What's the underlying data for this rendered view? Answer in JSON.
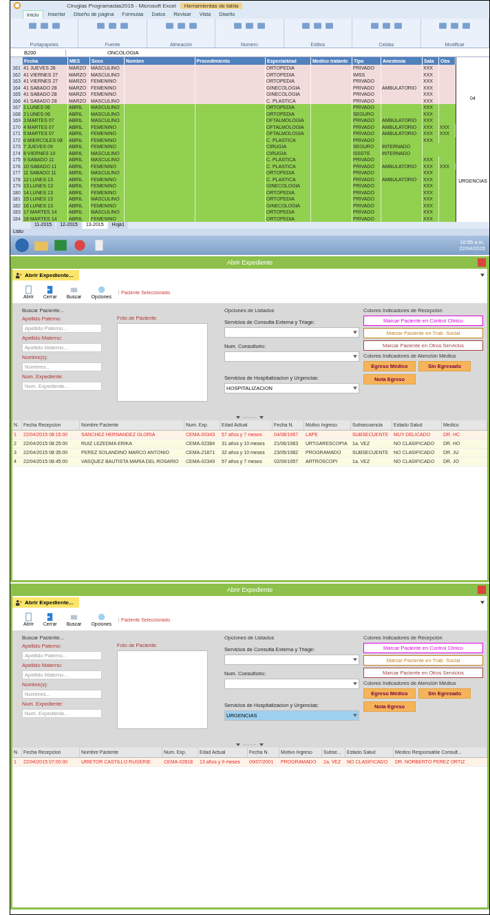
{
  "spreadsheet": {
    "title": "Cirugias Programadas2015 - Microsoft Excel",
    "tools_title": "Herramientas de tabla",
    "ribbon_tabs": [
      {
        "label": "Inicio",
        "selected": true
      },
      {
        "label": "Insertar",
        "selected": false
      },
      {
        "label": "Diseño de página",
        "selected": false
      },
      {
        "label": "Fórmulas",
        "selected": false
      },
      {
        "label": "Datos",
        "selected": false
      },
      {
        "label": "Revisar",
        "selected": false
      },
      {
        "label": "Vista",
        "selected": false
      },
      {
        "label": "Diseño",
        "selected": false
      }
    ],
    "ribbon_groups": [
      "Portapapeles",
      "Fuente",
      "Alineación",
      "Número",
      "Estilos",
      "Celdas",
      "Modificar"
    ],
    "name_box": "B200",
    "formula": "ONCOLOGIA",
    "columns": [
      "Fecha",
      "MES",
      "Sexo",
      "Nombre",
      "Procedimiento",
      "Especialidad",
      "Medico tratante",
      "Tipo",
      "Anestesia",
      "Sala",
      "Obs"
    ],
    "rows": [
      {
        "n": "161",
        "color": "#f2dcdb",
        "fecha": "41 JUEVES 26",
        "mes": "MARZO",
        "sexo": "MASCULINO",
        "esp": "ORTOPEDIA",
        "tipo": "PRIVADO",
        "marks": [
          "XXX"
        ]
      },
      {
        "n": "162",
        "color": "#f2dcdb",
        "fecha": "41 VIERNES 27",
        "mes": "MARZO",
        "sexo": "MASCULINO",
        "esp": "ORTOPEDIA",
        "tipo": "IMSS",
        "marks": [
          "XXX"
        ]
      },
      {
        "n": "163",
        "color": "#f2dcdb",
        "fecha": "41 VIERNES 27",
        "mes": "MARZO",
        "sexo": "FEMENINO",
        "esp": "ORTOPEDIA",
        "tipo": "PRIVADO",
        "marks": [
          "XXX"
        ]
      },
      {
        "n": "164",
        "color": "#f2dcdb",
        "fecha": "41 SABADO 28",
        "mes": "MARZO",
        "sexo": "FEMENINO",
        "esp": "GINECOLOGIA",
        "tipo": "PRIVADO",
        "anestesia": "AMBULATORIO",
        "marks": [
          "XXX"
        ]
      },
      {
        "n": "165",
        "color": "#f2dcdb",
        "fecha": "41 SABADO 28",
        "mes": "MARZO",
        "sexo": "FEMENINO",
        "esp": "GINECOLOGIA",
        "tipo": "PRIVADO",
        "marks": [
          "XXX"
        ]
      },
      {
        "n": "166",
        "color": "#f2dcdb",
        "fecha": "41 SABADO 28",
        "mes": "MARZO",
        "sexo": "MASCULINO",
        "esp": "C. PLASTICA",
        "tipo": "PRIVADO",
        "marks": [
          "XXX"
        ]
      },
      {
        "n": "167",
        "color": "#92d050",
        "fecha": "1 LUNES 06",
        "mes": "ABRIL",
        "sexo": "MASCULINO",
        "esp": "ORTOPEDIA",
        "tipo": "PRIVADO",
        "marks": [
          "XXX"
        ]
      },
      {
        "n": "168",
        "color": "#92d050",
        "fecha": "2 LUNES 06",
        "mes": "ABRIL",
        "sexo": "MASCULINO",
        "esp": "ORTOPEDIA",
        "tipo": "SEGURO",
        "marks": [
          "XXX"
        ]
      },
      {
        "n": "169",
        "color": "#92d050",
        "fecha": "3 MARTES 07",
        "mes": "ABRIL",
        "sexo": "MASCULINO",
        "esp": "OFTALMOLOGIA",
        "tipo": "PRIVADO",
        "anestesia": "AMBULATORIO",
        "marks": [
          "XXX"
        ]
      },
      {
        "n": "170",
        "color": "#92d050",
        "fecha": "4 MARTES 07",
        "mes": "ABRIL",
        "sexo": "FEMENINO",
        "esp": "OFTALMOLOGIA",
        "tipo": "PRIVADO",
        "anestesia": "AMBULATORIO",
        "marks": [
          "XXX",
          "XXX"
        ]
      },
      {
        "n": "171",
        "color": "#92d050",
        "fecha": "5 MARTES 07",
        "mes": "ABRIL",
        "sexo": "FEMENINO",
        "esp": "OFTALMOLOGIA",
        "tipo": "PRIVADO",
        "anestesia": "AMBULATORIO",
        "marks": [
          "XXX",
          "XXX"
        ]
      },
      {
        "n": "172",
        "color": "#92d050",
        "fecha": "6 MIERCOLES 08",
        "mes": "ABRIL",
        "sexo": "FEMENINO",
        "esp": "C. PLASTICA",
        "tipo": "PRIVADO",
        "marks": [
          "XXX"
        ]
      },
      {
        "n": "173",
        "color": "#92d050",
        "fecha": "7 JUEVES 09",
        "mes": "ABRIL",
        "sexo": "FEMENINO",
        "esp": "CIRUGIA",
        "tipo": "SEGURO",
        "anestesia": "INTERNADO",
        "marks": []
      },
      {
        "n": "174",
        "color": "#92d050",
        "fecha": "8 VIERNES 10",
        "mes": "ABRIL",
        "sexo": "MASCULINO",
        "esp": "CIRUGIA",
        "tipo": "ISSSTE",
        "anestesia": "INTERNADO",
        "marks": []
      },
      {
        "n": "175",
        "color": "#92d050",
        "fecha": "9 SABADO 11",
        "mes": "ABRIL",
        "sexo": "MASCULINO",
        "esp": "C. PLASTICA",
        "tipo": "PRIVADO",
        "marks": [
          "XXX"
        ]
      },
      {
        "n": "176",
        "color": "#92d050",
        "fecha": "10 SABADO 11",
        "mes": "ABRIL",
        "sexo": "FEMENINO",
        "esp": "C. PLASTICA",
        "tipo": "PRIVADO",
        "anestesia": "AMBULATORIO",
        "marks": [
          "XXX",
          "XXX"
        ]
      },
      {
        "n": "177",
        "color": "#92d050",
        "fecha": "11 SABADO 11",
        "mes": "ABRIL",
        "sexo": "MASCULINO",
        "esp": "ORTOPEDIA",
        "tipo": "PRIVADO",
        "marks": [
          "XXX"
        ]
      },
      {
        "n": "178",
        "color": "#92d050",
        "fecha": "12 LUNES 13",
        "mes": "ABRIL",
        "sexo": "FEMENINO",
        "esp": "C. PLASTICA",
        "tipo": "PRIVADO",
        "anestesia": "AMBULATORIO",
        "marks": [
          "XXX"
        ]
      },
      {
        "n": "179",
        "color": "#92d050",
        "fecha": "13 LUNES 13",
        "mes": "ABRIL",
        "sexo": "FEMENINO",
        "esp": "GINECOLOGIA",
        "tipo": "PRIVADO",
        "marks": [
          "XXX"
        ]
      },
      {
        "n": "180",
        "color": "#92d050",
        "fecha": "14 LUNES 13",
        "mes": "ABRIL",
        "sexo": "FEMENINO",
        "esp": "ORTOPEDIA",
        "tipo": "PRIVADO",
        "marks": [
          "XXX"
        ]
      },
      {
        "n": "181",
        "color": "#92d050",
        "fecha": "15 LUNES 13",
        "mes": "ABRIL",
        "sexo": "MASCULINO",
        "esp": "ORTOPEDIA",
        "tipo": "PRIVADO",
        "marks": [
          "XXX"
        ]
      },
      {
        "n": "182",
        "color": "#92d050",
        "fecha": "16 LUNES 13",
        "mes": "ABRIL",
        "sexo": "FEMENINO",
        "esp": "GINECOLOGIA",
        "tipo": "PRIVADO",
        "marks": [
          "XXX"
        ]
      },
      {
        "n": "183",
        "color": "#92d050",
        "fecha": "17 MARTES 14",
        "mes": "ABRIL",
        "sexo": "MASCULINO",
        "esp": "ORTOPEDIA",
        "tipo": "PRIVADO",
        "marks": [
          "XXX"
        ]
      },
      {
        "n": "184",
        "color": "#92d050",
        "fecha": "18 MARTES 14",
        "mes": "ABRIL",
        "sexo": "FEMENINO",
        "esp": "ORTOPEDIA",
        "tipo": "PRIVADO",
        "marks": [
          "XXX"
        ]
      }
    ],
    "side_labels": [
      "04",
      "URGENCIAS"
    ],
    "sheet_tabs": [
      {
        "label": "11-2015",
        "selected": false
      },
      {
        "label": "12-2015",
        "selected": false
      },
      {
        "label": "13-2015",
        "selected": true
      },
      {
        "label": "Hoja1",
        "selected": false
      }
    ],
    "status": "Listo"
  },
  "taskbar": {
    "time": "10:55 a.m.",
    "date": "22/04/2015"
  },
  "dialogs": [
    {
      "title": "Abrir Expediente",
      "tab": "Abrir Expediente...",
      "toolbar": [
        "Abrir",
        "Cerrar",
        "Buscar",
        "Opciones"
      ],
      "hint": "Paciente Seleccionado",
      "search_title": "Buscar Paciente...",
      "fields": [
        {
          "label": "Apellido Paterno:",
          "placeholder": "Apellido Paterno..."
        },
        {
          "label": "Apellido Materno:",
          "placeholder": "Apellido Materno..."
        },
        {
          "label": "Nombre(s):",
          "placeholder": "Nombres..."
        },
        {
          "label": "Num. Expediente:",
          "placeholder": "Num. Expediente..."
        }
      ],
      "photo_label": "Foto de Paciente:",
      "lists_title": "Opciones de Listados",
      "consulta_label": "Servicios de Consulta Externa y Triage:",
      "consultorio_label": "Num. Consultorio:",
      "hosp_label": "Servicios de Hospitalizacion y Urgencias:",
      "hosp_value": "HOSPITALIZACION",
      "hosp_selected": false,
      "reception_title": "Colores Indicadores de Recepción",
      "reception_buttons": [
        {
          "label": "Marcar Paciente en Control Clinico",
          "color": "#e000e0"
        },
        {
          "label": "Marcar Paciente en Trab. Social",
          "color": "#c08020"
        },
        {
          "label": "Marcar Paciente en Otros Servicios",
          "color": "#a04040"
        }
      ],
      "attention_title": "Colores Indicadores de Atención Médica",
      "attention_buttons": [
        "Egreso Médico",
        "Sin Egresado",
        "Nota Egreso"
      ],
      "table": {
        "columns": [
          "N.",
          "Fecha Recepcion",
          "Nombre Paciente",
          "Num. Exp.",
          "Edad Actual",
          "Fecha N.",
          "Motivo Ingreso",
          "Subsecuencia",
          "Estado Salud",
          "Medico"
        ],
        "rows": [
          {
            "alert": true,
            "cells": [
              "1",
              "22/04/2015 08:15:00",
              "SANCHEZ HERNANDEZ GLORIA",
              "CEMA-00343",
              "57 años y 7 meses",
              "04/08/1957",
              "LAPE",
              "SUBSECUENTE",
              "MUY DELICADO",
              "DR. HC"
            ]
          },
          {
            "alert": false,
            "cells": [
              "2",
              "22/04/2015 08:25:00",
              "RUIZ LEZEDMA ERIKA",
              "CEMA-02384",
              "31 años y 10 meses",
              "21/06/1983",
              "URTGARESCOPIA",
              "1a. VEZ",
              "NO CLASIFICADO",
              "DR. HO"
            ]
          },
          {
            "alert": false,
            "cells": [
              "3",
              "22/04/2015 08:35:00",
              "PEREZ SOLANDINO MARCO ANTONIO",
              "CEMA-21871",
              "32 años y 10 meses",
              "23/05/1982",
              "PROGRAMADO",
              "SUBSECUENTE",
              "NO CLASIFICADO",
              "DR. JU"
            ]
          },
          {
            "alert": false,
            "cells": [
              "4",
              "22/04/2015 08:45:00",
              "VASQUEZ BAUTISTA MARIA DEL ROSARIO",
              "CEMA-02349",
              "57 años y 7 meses",
              "02/09/1957",
              "ARTROSCOPI",
              "1a. VEZ",
              "NO CLASIFICADO",
              "DR. JO"
            ]
          }
        ]
      }
    },
    {
      "title": "Abrir Expediente",
      "tab": "Abrir Expediente...",
      "toolbar": [
        "Abrir",
        "Cerrar",
        "Buscar",
        "Opciones"
      ],
      "hint": "Paciente Seleccionado",
      "search_title": "Buscar Paciente...",
      "fields": [
        {
          "label": "Apellido Paterno:",
          "placeholder": "Apellido Paterno..."
        },
        {
          "label": "Apellido Materno:",
          "placeholder": "Apellido Materno..."
        },
        {
          "label": "Nombre(s):",
          "placeholder": "Nombres..."
        },
        {
          "label": "Num. Expediente:",
          "placeholder": "Num. Expediente..."
        }
      ],
      "photo_label": "Foto de Paciente:",
      "lists_title": "Opciones de Listados",
      "consulta_label": "Servicios de Consulta Externa y Triage:",
      "consultorio_label": "Num. Consultorio:",
      "hosp_label": "Servicios de Hospitalizacion y Urgencias:",
      "hosp_value": "URGENCIAS",
      "hosp_selected": true,
      "reception_title": "Colores Indicadores de Recepción",
      "reception_buttons": [
        {
          "label": "Marcar Paciente en Control Clinico",
          "color": "#e000e0"
        },
        {
          "label": "Marcar Paciente en Trab. Social",
          "color": "#c08020"
        },
        {
          "label": "Marcar Paciente en Otros Servicios",
          "color": "#a04040"
        }
      ],
      "attention_title": "Colores Indicadores de Atención Médica",
      "attention_buttons": [
        "Egreso Médico",
        "Sin Egresado",
        "Nota Egreso"
      ],
      "table": {
        "columns": [
          "N.",
          "Fecha Recepcion",
          "Nombre Paciente",
          "Num. Exp.",
          "Edad Actual",
          "Fecha N.",
          "Motivo Ingreso",
          "Subse...",
          "Estado Salud",
          "Medico Responsable Consult..."
        ],
        "rows": [
          {
            "alert": true,
            "cells": [
              "1",
              "22/04/2015 07:00:00",
              "URIETOR CASTILLO RUGERIE",
              "CEMA-02818",
              "13 años y 9 meses",
              "09/07/2001",
              "PROGRAMADO",
              "1a. VEZ",
              "NO CLASIFICADO",
              "DR. NORBERTO PEREZ ORTIZ"
            ]
          }
        ]
      }
    }
  ]
}
